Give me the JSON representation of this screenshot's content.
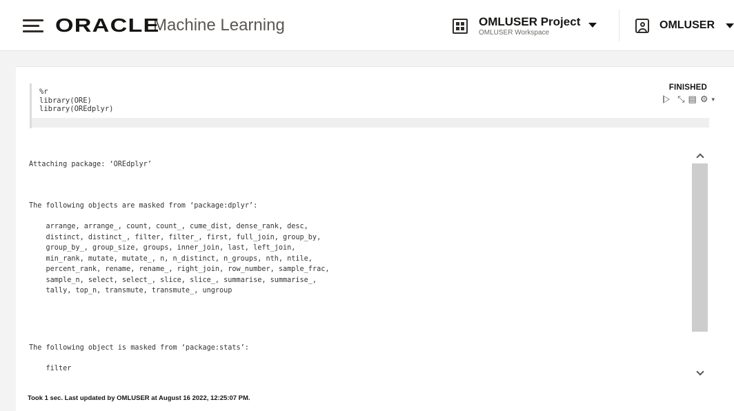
{
  "header": {
    "logo_text": "ORACLE",
    "product_name": "Machine Learning",
    "project_name": "OMLUSER Project",
    "workspace_name": "OMLUSER Workspace",
    "user_name": "OMLUSER"
  },
  "paragraph": {
    "status": "FINISHED",
    "code_lines": [
      "%r",
      "library(ORE)",
      "library(OREdplyr)"
    ],
    "output": {
      "block1": "Attaching package: ‘OREdplyr’",
      "block2_title": "The following objects are masked from ‘package:dplyr’:",
      "block2_list": "    arrange, arrange_, count, count_, cume_dist, dense_rank, desc,\n    distinct, distinct_, filter, filter_, first, full_join, group_by,\n    group_by_, group_size, groups, inner_join, last, left_join,\n    min_rank, mutate, mutate_, n, n_distinct, n_groups, nth, ntile,\n    percent_rank, rename, rename_, right_join, row_number, sample_frac,\n    sample_n, select, select_, slice, slice_, summarise, summarise_,\n    tally, top_n, transmute, transmute_, ungroup",
      "block3_title": "The following object is masked from ‘package:stats’:",
      "block3_partial": "    filter"
    },
    "footer": "Took 1 sec. Last updated by OMLUSER at August 16 2022, 12:25:07 PM."
  },
  "icons": [
    "hamburger-menu-icon",
    "project-grid-icon",
    "user-icon",
    "run-icon",
    "collapse-icon",
    "book-icon",
    "gear-icon",
    "chevron-up-icon",
    "chevron-down-icon"
  ]
}
